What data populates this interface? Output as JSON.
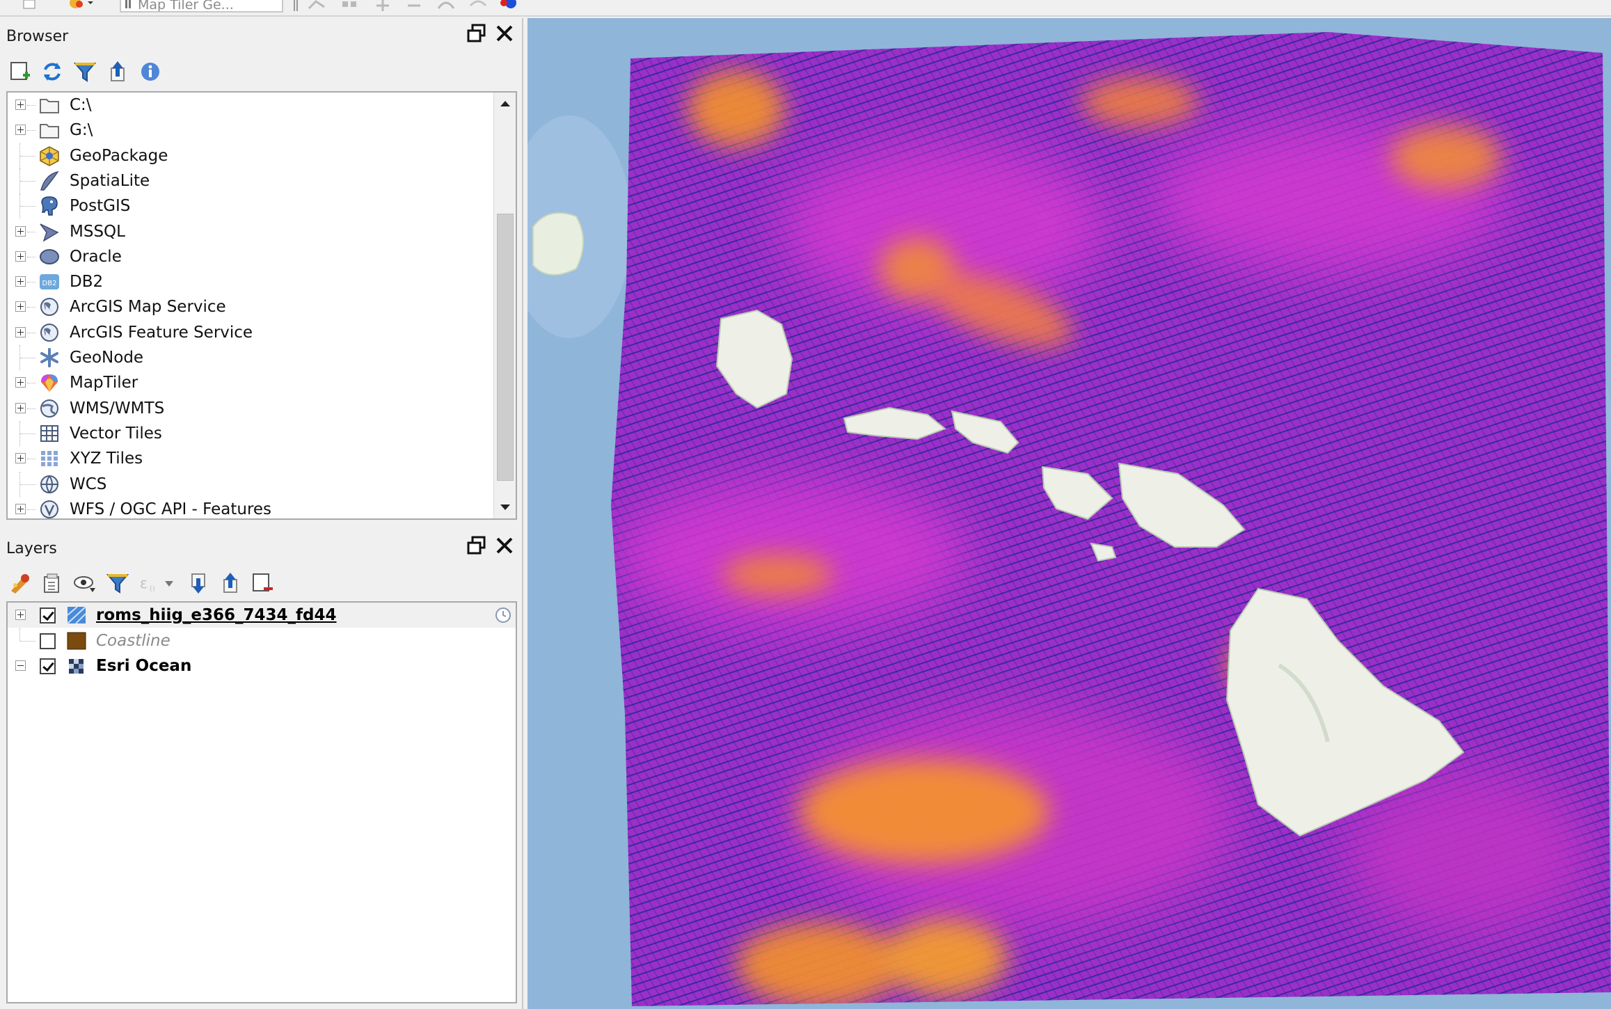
{
  "toolbar": {
    "locator_placeholder": "Map Tiler Ge..."
  },
  "browser": {
    "title": "Browser",
    "items": [
      {
        "label": "C:\\",
        "icon": "folder-icon",
        "expandable": true
      },
      {
        "label": "G:\\",
        "icon": "folder-icon",
        "expandable": true
      },
      {
        "label": "GeoPackage",
        "icon": "geopackage-icon",
        "expandable": false
      },
      {
        "label": "SpatiaLite",
        "icon": "spatialite-icon",
        "expandable": false
      },
      {
        "label": "PostGIS",
        "icon": "postgis-elephant-icon",
        "expandable": false
      },
      {
        "label": "MSSQL",
        "icon": "mssql-icon",
        "expandable": true
      },
      {
        "label": "Oracle",
        "icon": "oracle-icon",
        "expandable": true
      },
      {
        "label": "DB2",
        "icon": "db2-icon",
        "icon_text": "DB2",
        "expandable": true
      },
      {
        "label": "ArcGIS Map Service",
        "icon": "arcgis-globe-icon",
        "expandable": true
      },
      {
        "label": "ArcGIS Feature Service",
        "icon": "arcgis-globe-icon",
        "expandable": true
      },
      {
        "label": "GeoNode",
        "icon": "geonode-icon",
        "expandable": false
      },
      {
        "label": "MapTiler",
        "icon": "maptiler-icon",
        "expandable": true
      },
      {
        "label": "WMS/WMTS",
        "icon": "wms-globe-icon",
        "expandable": true
      },
      {
        "label": "Vector Tiles",
        "icon": "vector-tiles-icon",
        "expandable": false
      },
      {
        "label": "XYZ Tiles",
        "icon": "xyz-tiles-icon",
        "expandable": true
      },
      {
        "label": "WCS",
        "icon": "wcs-globe-icon",
        "expandable": false
      },
      {
        "label": "WFS / OGC API - Features",
        "icon": "wfs-globe-icon",
        "expandable": true
      }
    ]
  },
  "layers": {
    "title": "Layers",
    "items": [
      {
        "label": "roms_hiig_e366_7434_fd44",
        "checked": true,
        "icon": "mesh-layer-icon",
        "style": "bold-underline",
        "expander": "plus",
        "has_temporal": true
      },
      {
        "label": "Coastline",
        "checked": false,
        "icon": "fill-swatch-icon",
        "style": "italic-gray",
        "expander": "none",
        "swatch_color": "#7a4a0e"
      },
      {
        "label": "Esri Ocean",
        "checked": true,
        "icon": "raster-layer-icon",
        "style": "bold",
        "expander": "minus"
      }
    ]
  },
  "colors": {
    "flow_purple": "#9b2fc9",
    "flow_magenta": "#d43ad0",
    "flow_orange": "#f5922a",
    "ocean": "#8fb5d9",
    "land": "#eef0e8"
  }
}
